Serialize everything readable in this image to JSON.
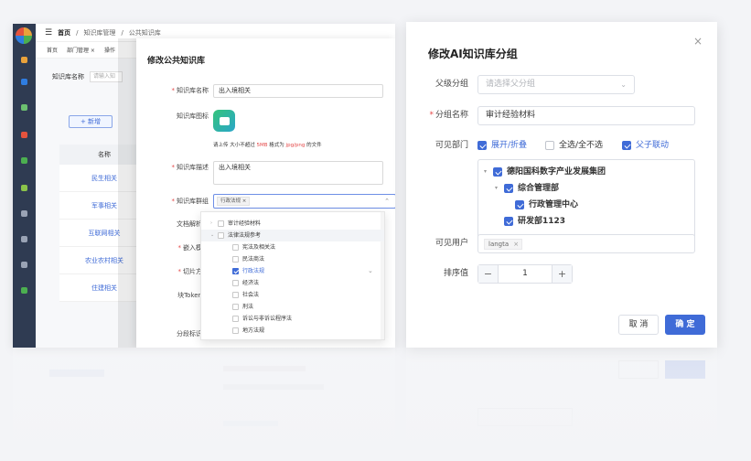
{
  "left": {
    "topbar": {
      "home": "首页",
      "crumb1": "知识库管理",
      "crumb2": "公共知识库"
    },
    "tabs": [
      "首页",
      "部门管理 ×",
      "操作"
    ],
    "search": {
      "label": "知识库名称",
      "placeholder": "请输入知"
    },
    "add_button": "+ 新增",
    "table": {
      "header": "名称",
      "rows": [
        "民生相关",
        "军事相关",
        "互联网相关",
        "农业农村相关",
        "住建相关"
      ]
    },
    "drawer": {
      "title": "修改公共知识库",
      "name_label": "知识库名称",
      "name_value": "出入境相关",
      "icon_label": "知识库图标",
      "upload_hint_prefix": "请上传 大小不超过",
      "upload_hint_size": "5MB",
      "upload_hint_mid": "格式为",
      "upload_hint_format": "jpg/png",
      "upload_hint_suffix": "的文件",
      "desc_label": "知识库描述",
      "desc_value": "出入境相关",
      "group_label": "知识库群组",
      "group_tag": "行政法规",
      "parser_label": "文档解析器",
      "embed_label": "嵌入模型",
      "chunk_label": "切片方法",
      "token_label": "块Token数",
      "seg_label": "分段标识符"
    },
    "dropdown": [
      {
        "label": "审计经验材料",
        "level": 0,
        "arrow": "›",
        "checked": false,
        "highlight": false
      },
      {
        "label": "法律法规参考",
        "level": 0,
        "arrow": "⌄",
        "checked": false,
        "highlight": true
      },
      {
        "label": "宪法及相关法",
        "level": 1,
        "arrow": "",
        "checked": false,
        "highlight": false
      },
      {
        "label": "民法商法",
        "level": 1,
        "arrow": "",
        "checked": false,
        "highlight": false
      },
      {
        "label": "行政法规",
        "level": 1,
        "arrow": "",
        "checked": true,
        "highlight": false
      },
      {
        "label": "经济法",
        "level": 1,
        "arrow": "",
        "checked": false,
        "highlight": false
      },
      {
        "label": "社会法",
        "level": 1,
        "arrow": "",
        "checked": false,
        "highlight": false
      },
      {
        "label": "刑法",
        "level": 1,
        "arrow": "",
        "checked": false,
        "highlight": false
      },
      {
        "label": "诉讼与非诉讼程序法",
        "level": 1,
        "arrow": "",
        "checked": false,
        "highlight": false
      },
      {
        "label": "地方法规",
        "level": 1,
        "arrow": "",
        "checked": false,
        "highlight": false
      }
    ]
  },
  "right": {
    "title": "修改AI知识库分组",
    "close": "×",
    "parent_label": "父级分组",
    "parent_placeholder": "请选择父分组",
    "name_label": "分组名称",
    "name_value": "审计经验材料",
    "dept_label": "可见部门",
    "opt_expand": "展开/折叠",
    "opt_all": "全选/全不选",
    "opt_link": "父子联动",
    "tree": [
      {
        "label": "德阳国科数字产业发展集团",
        "level": 0,
        "arrow": "▾",
        "checked": true
      },
      {
        "label": "综合管理部",
        "level": 1,
        "arrow": "▾",
        "checked": true
      },
      {
        "label": "行政管理中心",
        "level": 2,
        "arrow": "",
        "checked": true
      },
      {
        "label": "研发部1123",
        "level": 1,
        "arrow": "",
        "checked": true
      }
    ],
    "user_label": "可见用户",
    "user_tag": "langta",
    "sort_label": "排序值",
    "sort_value": "1",
    "minus": "−",
    "plus": "+",
    "cancel": "取 消",
    "ok": "确 定"
  }
}
